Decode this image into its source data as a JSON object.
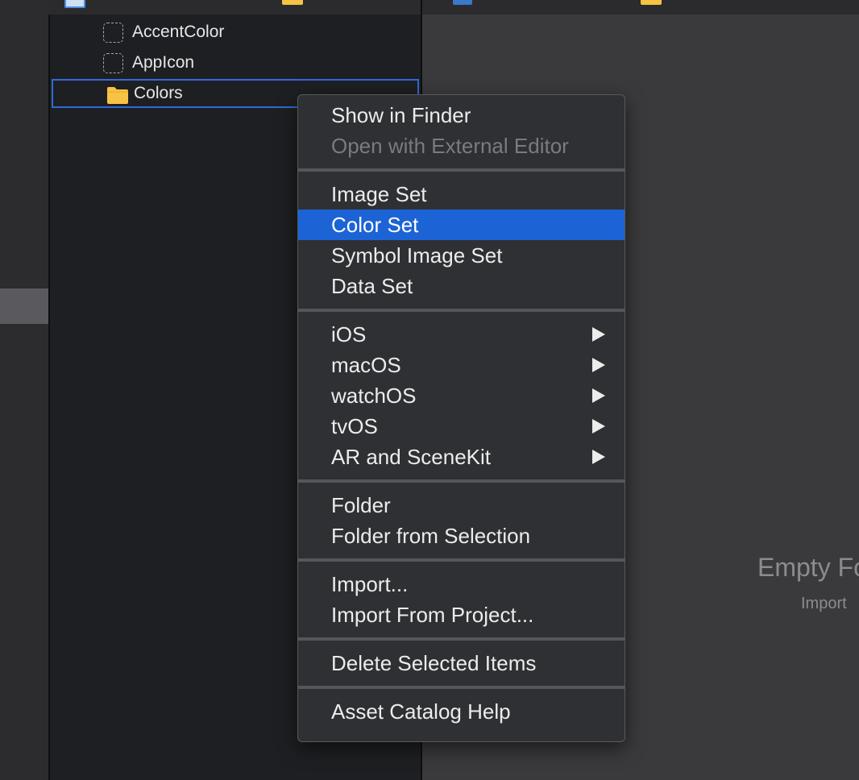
{
  "outline": {
    "items": [
      {
        "label": "AccentColor",
        "icon": "dashed-asset-icon"
      },
      {
        "label": "AppIcon",
        "icon": "dashed-asset-icon"
      },
      {
        "label": "Colors",
        "icon": "folder-icon",
        "selected": true
      }
    ]
  },
  "editor": {
    "empty_title": "Empty Fo",
    "empty_subtitle": "Import"
  },
  "menu": {
    "show_in_finder": "Show in Finder",
    "open_external": "Open with External Editor",
    "image_set": "Image Set",
    "color_set": "Color Set",
    "symbol_image_set": "Symbol Image Set",
    "data_set": "Data Set",
    "ios": "iOS",
    "macos": "macOS",
    "watchos": "watchOS",
    "tvos": "tvOS",
    "ar_scenekit": "AR and SceneKit",
    "folder": "Folder",
    "folder_from_selection": "Folder from Selection",
    "import": "Import...",
    "import_from_project": "Import From Project...",
    "delete_selected": "Delete Selected Items",
    "help": "Asset Catalog Help"
  },
  "colors": {
    "highlight": "#1c63d6",
    "selection_border": "#2f6bd8",
    "folder": "#f6c344"
  }
}
